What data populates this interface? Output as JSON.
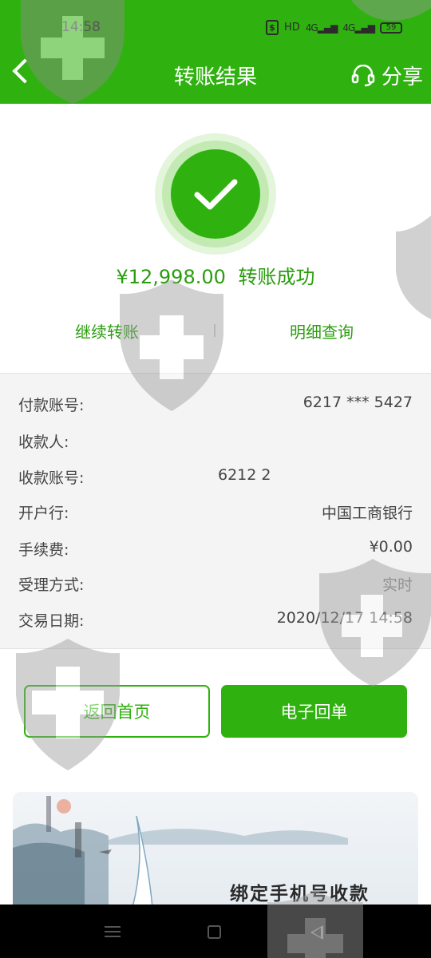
{
  "status_bar": {
    "time": "14:58",
    "hd": "HD",
    "net1": "4G",
    "net2": "4G",
    "battery": "59"
  },
  "header": {
    "title": "转账结果",
    "share_label": "分享"
  },
  "result": {
    "amount": "¥12,998.00",
    "status": "转账成功",
    "continue_label": "继续转账",
    "detail_label": "明细查询"
  },
  "details": [
    {
      "label": "付款账号:",
      "value": "6217 *** 5427"
    },
    {
      "label": "收款人:",
      "value": ""
    },
    {
      "label": "收款账号:",
      "value": "6212 2"
    },
    {
      "label": "开户行:",
      "value": "中国工商银行"
    },
    {
      "label": "手续费:",
      "value": "¥0.00"
    },
    {
      "label": "受理方式:",
      "value": "实时"
    },
    {
      "label": "交易日期:",
      "value": "2020/12/17 14:58"
    }
  ],
  "buttons": {
    "home": "返回首页",
    "receipt": "电子回单"
  },
  "banner": {
    "text": "绑定手机号收款"
  },
  "colors": {
    "brand_green": "#2fb20f",
    "text_green": "#2a9d0e",
    "detail_bg": "#f4f4f4"
  },
  "icons": [
    "back-arrow-icon",
    "headset-icon",
    "check-icon",
    "menu-icon",
    "home-icon",
    "back-triangle-icon",
    "shield-watermark-icon"
  ]
}
